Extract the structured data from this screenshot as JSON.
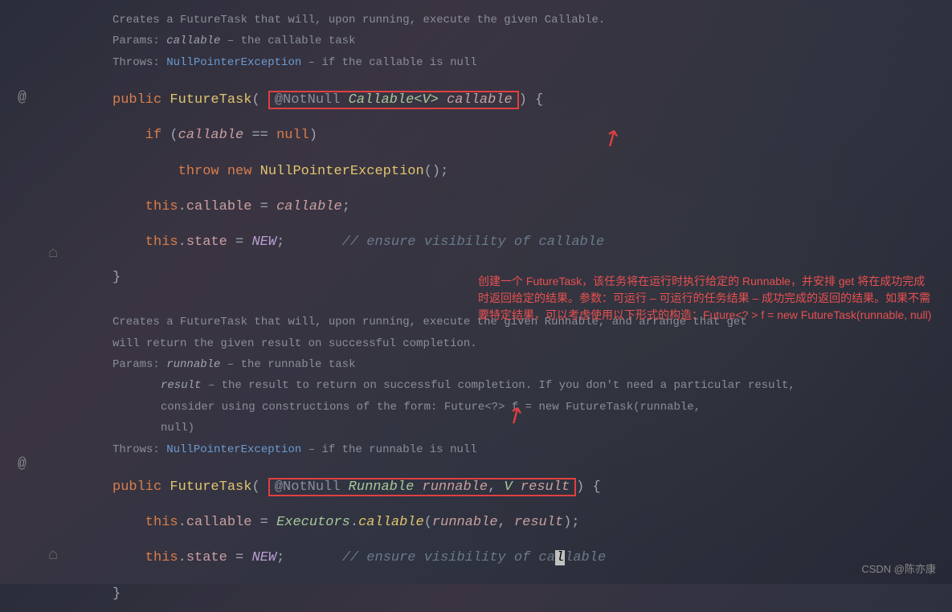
{
  "doc1": {
    "desc_pre": "Creates a FutureTask that will, upon running, execute the given ",
    "desc_code": "Callable",
    "desc_post": ".",
    "params_label": "Params:",
    "param_name": "callable",
    "param_desc": " – the callable task",
    "throws_label": "Throws:",
    "throws_type": "NullPointerException",
    "throws_desc": " – if the callable is null"
  },
  "code1": {
    "l1_public": "public",
    "l1_type": " FutureTask",
    "l1_open": "( ",
    "l1_ann": "@NotNull",
    "l1_ptype": " Callable<V>",
    "l1_pname": " callable",
    "l1_close": ") {",
    "l2": "    if ",
    "l2_cond_open": "(",
    "l2_var": "callable",
    "l2_eq": " == ",
    "l2_null": "null",
    "l2_cond_close": ")",
    "l3_throw": "        throw ",
    "l3_new": "new ",
    "l3_ex": "NullPointerException",
    "l3_end": "();",
    "l4_this": "    this",
    "l4_dot": ".",
    "l4_field": "callable",
    "l4_eq": " = ",
    "l4_val": "callable",
    "l4_semi": ";",
    "l5_this": "    this",
    "l5_dot": ".",
    "l5_field": "state",
    "l5_eq": " = ",
    "l5_val": "NEW",
    "l5_semi": ";       ",
    "l5_comment": "// ensure visibility of callable",
    "l6": "}"
  },
  "doc2": {
    "desc1": "Creates a FutureTask that will, upon running, execute the given Runnable, and arrange that get",
    "desc2": "will return the given result on successful completion.",
    "params_label": "Params:",
    "p1_name": "runnable",
    "p1_desc": " – the runnable task",
    "p2_name": "result",
    "p2_desc": " – the result to return on successful completion. If you don't need a particular result,",
    "p2_desc2": "consider using constructions of the form: ",
    "p2_code": "Future<?> f = new FutureTask(runnable,",
    "p2_code2": "null)",
    "throws_label": "Throws:",
    "throws_type": "NullPointerException",
    "throws_desc": " – if the runnable is null"
  },
  "code2": {
    "l1_public": "public",
    "l1_type": " FutureTask",
    "l1_open": "( ",
    "l1_ann": "@NotNull",
    "l1_ptype1": " Runnable",
    "l1_pname1": " runnable",
    "l1_comma": ",",
    "l1_ptype2": " V",
    "l1_pname2": " result",
    "l1_close": ") {",
    "l2_this": "    this",
    "l2_dot": ".",
    "l2_field": "callable",
    "l2_eq": " = ",
    "l2_cls": "Executors",
    "l2_dot2": ".",
    "l2_method": "callable",
    "l2_open": "(",
    "l2_arg1": "runnable",
    "l2_comma": ", ",
    "l2_arg2": "result",
    "l2_close": ");",
    "l3_this": "    this",
    "l3_dot": ".",
    "l3_field": "state",
    "l3_eq": " = ",
    "l3_val": "NEW",
    "l3_semi": ";       ",
    "l3_comment_pre": "// ensure visibility of ca",
    "l3_cursor": "l",
    "l3_comment_post": "lable",
    "l4": "}"
  },
  "annotation": {
    "text": "创建一个 FutureTask，该任务将在运行时执行给定的 Runnable，并安排 get 将在成功完成时返回给定的结果。参数：可运行 – 可运行的任务结果 – 成功完成的返回的结果。如果不需要特定结果，可以考虑使用以下形式的构造：Future<? > f = new FutureTask(runnable,    null)"
  },
  "gutter": {
    "at": "@",
    "home": "⌂"
  },
  "watermark": "CSDN @陈亦康"
}
